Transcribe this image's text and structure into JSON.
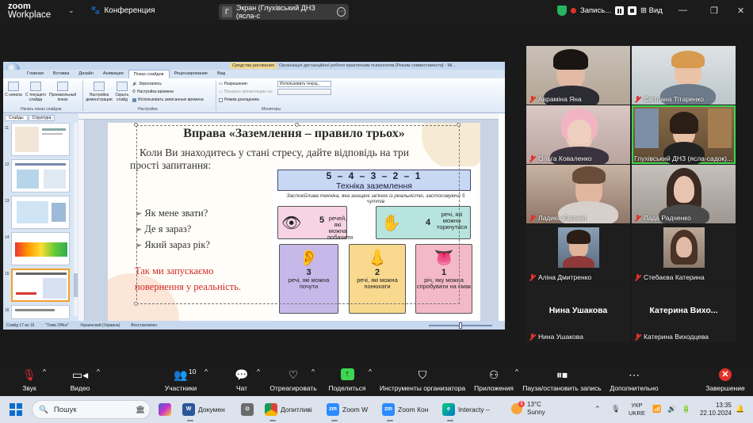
{
  "window": {
    "brand_line1": "zoom",
    "brand_line2": "Workplace",
    "conference_label": "Конференция",
    "shared_screen_initial": "Г",
    "shared_screen_label": "Экран (Глухівський ДНЗ (ясла-с",
    "recording_label": "Запись...",
    "view_label": "Вид"
  },
  "powerpoint": {
    "context_tab": "Средства рисования",
    "doc_title": "Організація дистанційної роботи практичним психологом [Режим совместимости] - Mi...",
    "tabs": [
      "Главная",
      "Вставка",
      "Дизайн",
      "Анимация",
      "Показ слайдов",
      "Рецензирование",
      "Вид"
    ],
    "active_tab": 4,
    "ribbon": {
      "btn_start": "С начала",
      "btn_current": "С текущего слайда",
      "btn_custom": "Произвольный показ",
      "group_start": "Начать показ слайдов",
      "btn_setup": "Настройка демонстрации",
      "btn_hide": "Скрыть слайд",
      "line_audio": "Звукозапись",
      "line_timing": "Настройка времени",
      "line_use_timing": "Использовать записанные времена",
      "group_setup": "Настройка",
      "line_resolution": "Разрешение:",
      "combo_resolution": "Использовать текущ...",
      "line_show_on": "Показать презентацию на:",
      "line_presenter": "Режим докладчика",
      "group_monitors": "Мониторы"
    },
    "left_tabs": [
      "Слайды",
      "Структура"
    ],
    "thumb_numbers": [
      "11",
      "12",
      "13",
      "14",
      "15",
      "16"
    ],
    "status": {
      "slide": "Слайд 17 из 16",
      "theme": "\"Тема Office\"",
      "lang": "Украинский (Украина)",
      "restore": "Восстановлен"
    },
    "slide": {
      "title": "Вправа «Заземлення – правило трьох»",
      "subtitle": "Коли Ви знаходитесь у стані стресу, дайте відповідь на три прості запитання:",
      "questions": [
        "Як мене звати?",
        "Де я зараз?",
        "Який зараз рік?"
      ],
      "red_line1": "Так ми запускаємо",
      "red_line2": "повернення у реальність.",
      "tech_numbers": "5 – 4 – 3 – 2 – 1",
      "tech_label": "Техніка заземлення",
      "tech_desc": "Заспокійлива техніка, яка знищює зв'язок із реальністю, застосовуючи 5 чуттів",
      "cards": [
        {
          "num": "5",
          "text": "речей, які можна побачити",
          "color": "#f7d3e3"
        },
        {
          "num": "4",
          "text": "речі, які можна торкнутися",
          "color": "#b7e4de"
        },
        {
          "num": "3",
          "text": "речі, які можна почути",
          "color": "#c7b8ea"
        },
        {
          "num": "2",
          "text": "речі, які можна понюхати",
          "color": "#f9d98e"
        },
        {
          "num": "1",
          "text": "річ, яку можна спробувати на смак",
          "color": "#f4b9c8"
        }
      ]
    }
  },
  "participants": [
    {
      "name": "Авраміна Яна",
      "muted": true
    },
    {
      "name": "Світлана Тітаренко",
      "muted": true
    },
    {
      "name": "Ольга Коваленко",
      "muted": true
    },
    {
      "name": "Глухівський ДНЗ (ясла-садок)...",
      "muted": false,
      "active": true
    },
    {
      "name": "Ладика Євгенія",
      "muted": true
    },
    {
      "name": "Лада Радченко",
      "muted": true
    },
    {
      "name": "Аліна Дмитренко",
      "muted": true
    },
    {
      "name": "Стебаєва Катерина",
      "muted": true
    },
    {
      "name": "Нина Ушакова",
      "muted": true,
      "big": "Нина Ушакова"
    },
    {
      "name": "Катерина Виходцева",
      "muted": true,
      "big": "Катерина Вихо..."
    }
  ],
  "toolbar": {
    "audio": "Звук",
    "video": "Видео",
    "participants": "Участники",
    "participants_count": "10",
    "chat": "Чат",
    "react": "Отреагировать",
    "share": "Поделиться",
    "host_tools": "Инструменты организатора",
    "apps": "Приложения",
    "pause_rec": "Пауза/остановить запись",
    "more": "Дополнительно",
    "end": "Завершение"
  },
  "taskbar": {
    "search": "Пошук",
    "apps": [
      "Докумен",
      "",
      "Допитливі",
      "Zoom W",
      "Zoom Кон",
      "Interacty –"
    ],
    "weather_temp": "13°C",
    "weather_desc": "Sunny",
    "lang1": "УКР",
    "lang2": "UKRE",
    "time": "13:35",
    "date": "22.10.2024",
    "notif": "1"
  }
}
